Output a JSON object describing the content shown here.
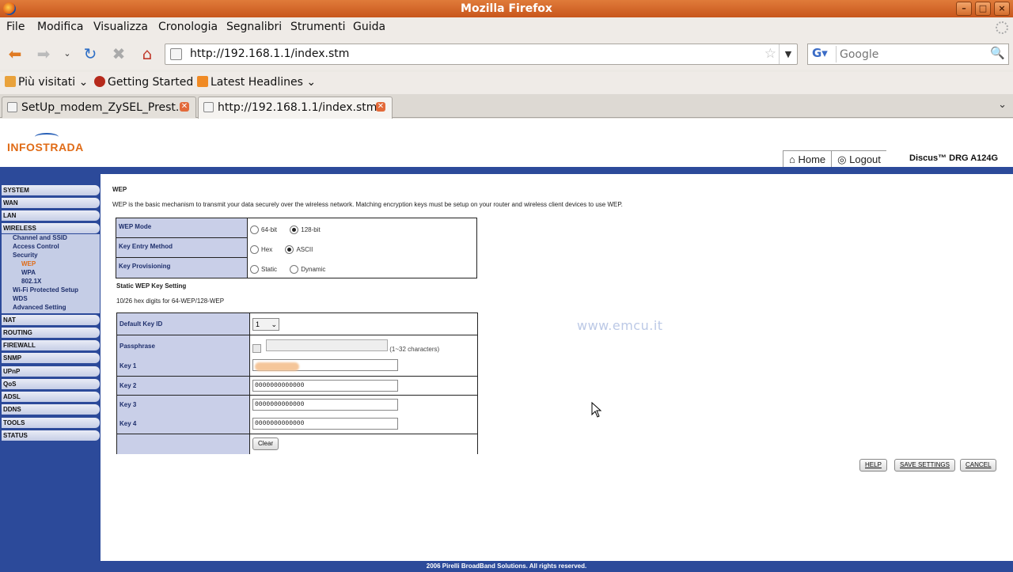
{
  "window": {
    "title": "Mozilla Firefox",
    "controls": [
      "–",
      "□",
      "×"
    ]
  },
  "menu": [
    "File",
    "Modifica",
    "Visualizza",
    "Cronologia",
    "Segnalibri",
    "Strumenti",
    "Guida"
  ],
  "nav": {
    "url": "http://192.168.1.1/index.stm",
    "search_placeholder": "Google"
  },
  "bookmarks": [
    "Più visitati",
    "Getting Started",
    "Latest Headlines"
  ],
  "tabs": [
    "SetUp_modem_ZySEL_Prest...",
    "http://192.168.1.1/index.stm"
  ],
  "router": {
    "logo": "INFOSTRADA",
    "top_nav": [
      "Home",
      "Logout"
    ],
    "model": "Discus™ DRG A124G",
    "sidebar": {
      "items": [
        "SYSTEM",
        "WAN",
        "LAN",
        "WIRELESS",
        "NAT",
        "ROUTING",
        "FIREWALL",
        "SNMP",
        "UPnP",
        "QoS",
        "ADSL",
        "DDNS",
        "TOOLS",
        "STATUS"
      ],
      "wireless_sub": [
        "Channel and SSID",
        "Access Control",
        "Security",
        "WEP",
        "WPA",
        "802.1X",
        "Wi-Fi Protected Setup",
        "WDS",
        "Advanced Setting"
      ]
    },
    "content": {
      "title": "WEP",
      "description": "WEP is the basic mechanism to transmit your data securely over the wireless network. Matching encryption keys must be setup on your router and wireless client devices to use WEP.",
      "wep_mode_label": "WEP Mode",
      "wep_mode_options": [
        "64-bit",
        "128-bit"
      ],
      "key_entry_label": "Key Entry Method",
      "key_entry_options": [
        "Hex",
        "ASCII"
      ],
      "key_prov_label": "Key Provisioning",
      "key_prov_options": [
        "Static",
        "Dynamic"
      ],
      "static_section": "Static WEP Key Setting",
      "static_hint": "10/26 hex digits for 64-WEP/128-WEP",
      "default_key_label": "Default Key ID",
      "default_key_value": "1",
      "passphrase_label": "Passphrase",
      "passphrase_hint": "(1~32 characters)",
      "key1_label": "Key 1",
      "key2_label": "Key 2",
      "key2_value": "0000000000000",
      "key3_label": "Key 3",
      "key3_value": "0000000000000",
      "key4_label": "Key 4",
      "key4_value": "0000000000000",
      "clear_btn": "Clear"
    },
    "buttons": [
      "HELP",
      "SAVE SETTINGS",
      "CANCEL"
    ],
    "watermark": "www.emcu.it",
    "footer": "2006 Pirelli BroadBand Solutions. All rights reserved."
  }
}
